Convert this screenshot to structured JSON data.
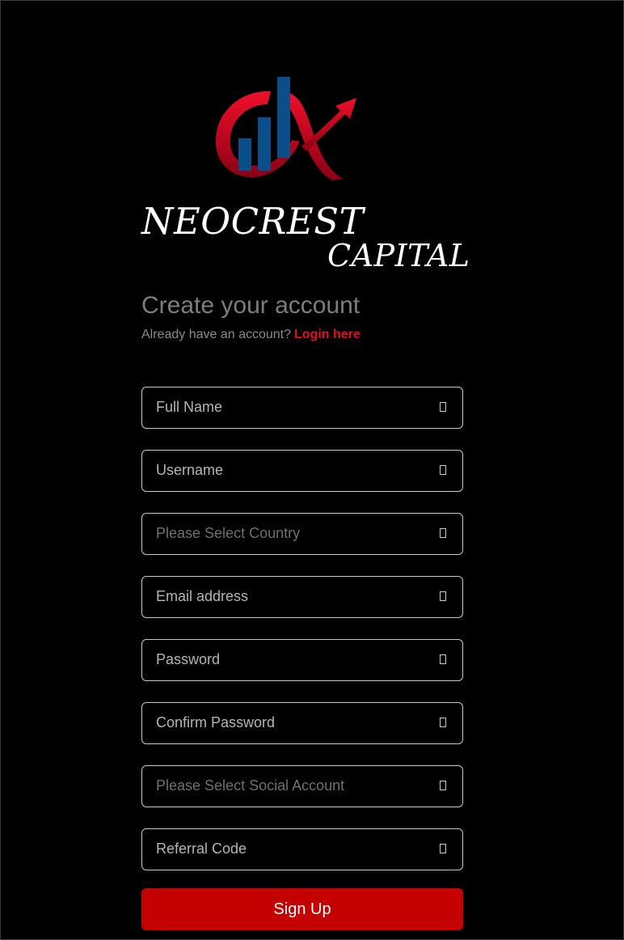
{
  "brand": {
    "name_line1": "NEOCREST",
    "name_line2": "CAPITAL",
    "logo_colors": {
      "swoosh": "#e0102a",
      "bars": "#0b4f8a"
    }
  },
  "header": {
    "title": "Create your account",
    "prompt": "Already have an account?",
    "login_link": "Login here"
  },
  "form": {
    "fields": [
      {
        "label": "Full Name",
        "kind": "text",
        "icon": "field-icon"
      },
      {
        "label": "Username",
        "kind": "text",
        "icon": "field-icon"
      },
      {
        "label": "Please Select Country",
        "kind": "select",
        "icon": "field-icon"
      },
      {
        "label": "Email address",
        "kind": "text",
        "icon": "field-icon"
      },
      {
        "label": "Password",
        "kind": "password",
        "icon": "field-icon"
      },
      {
        "label": "Confirm Password",
        "kind": "password",
        "icon": "field-icon"
      },
      {
        "label": "Please Select Social Account",
        "kind": "select",
        "icon": "field-icon"
      },
      {
        "label": "Referral Code",
        "kind": "text",
        "icon": "field-icon"
      }
    ],
    "submit_label": "Sign Up"
  },
  "colors": {
    "background": "#000000",
    "accent": "#c40000",
    "link": "#e0101c"
  }
}
